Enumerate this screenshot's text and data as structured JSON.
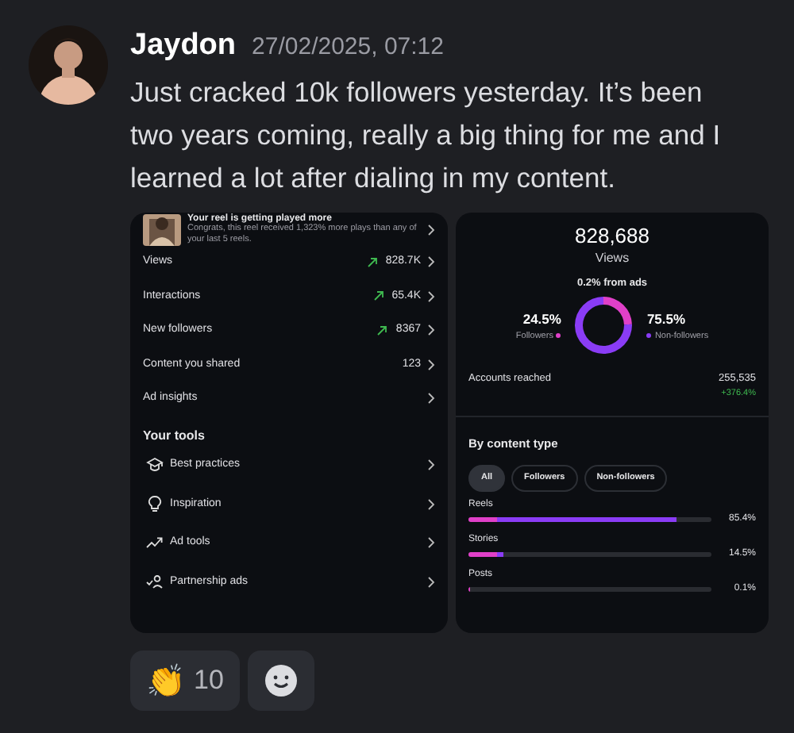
{
  "message": {
    "author": "Jaydon",
    "timestamp": "27/02/2025, 07:12",
    "text": "Just cracked 10k followers yesterday. It’s been two years coming, really a big thing for me and I learned a lot after dialing in my content."
  },
  "insights": {
    "banner": {
      "title": "Your reel is getting played more",
      "text": "Congrats, this reel received 1,323% more plays than any of your last 5 reels."
    },
    "metrics": [
      {
        "label": "Views",
        "value": "828.7K",
        "trending_up": true
      },
      {
        "label": "Interactions",
        "value": "65.4K",
        "trending_up": true
      },
      {
        "label": "New followers",
        "value": "8367",
        "trending_up": true
      },
      {
        "label": "Content you shared",
        "value": "123",
        "trending_up": false
      },
      {
        "label": "Ad insights",
        "trending_up": false
      }
    ],
    "tools_heading": "Your tools",
    "tools": [
      "Best practices",
      "Inspiration",
      "Ad tools",
      "Partnership ads"
    ]
  },
  "views": {
    "total": "828,688",
    "from_ads": "0.2% from ads",
    "followers": {
      "percent": "24.5%",
      "color": "#e040c8"
    },
    "non_followers": {
      "percent": "75.5%",
      "color": "#8a3cf5"
    },
    "chart_data": {
      "type": "donut",
      "categories": [
        "Followers",
        "Non-followers"
      ],
      "series": [
        {
          "name": "Views",
          "values": [
            24.5,
            75.5
          ]
        }
      ]
    },
    "accounts_reached": {
      "label": "Accounts reached",
      "value": "255,535",
      "change": "+376.4%"
    },
    "content_heading": "By content type",
    "filters": [
      {
        "label": "All",
        "selected": true
      },
      {
        "label": "Followers",
        "selected": false
      },
      {
        "label": "Non-followers",
        "selected": false
      }
    ],
    "content_types": [
      {
        "label": "Reels",
        "percent": "85.4%",
        "level": 0.854
      },
      {
        "label": "Stories",
        "percent": "14.5%",
        "level": 0.145
      },
      {
        "label": "Posts",
        "percent": "0.1%",
        "level": 0.001
      }
    ]
  },
  "reactions": [
    {
      "emoji": "👏",
      "count": "10"
    }
  ],
  "add_reaction": true
}
